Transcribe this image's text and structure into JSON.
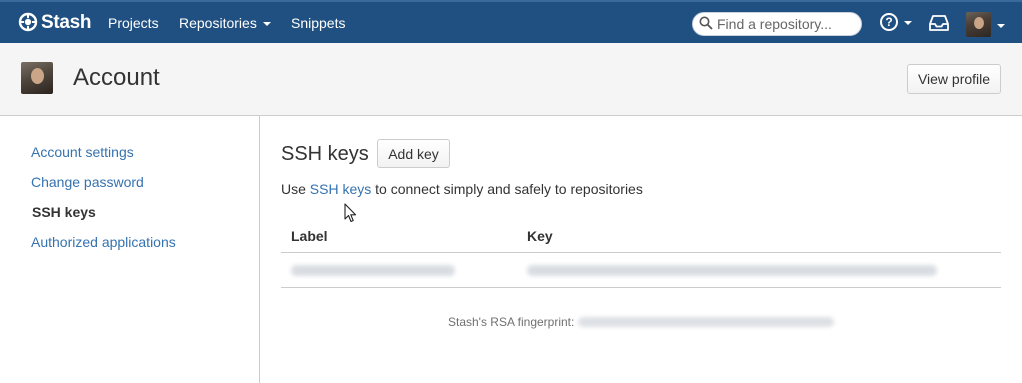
{
  "header": {
    "logo_text": "Stash",
    "nav": [
      {
        "label": "Projects"
      },
      {
        "label": "Repositories"
      },
      {
        "label": "Snippets"
      }
    ],
    "search": {
      "placeholder": "Find a repository..."
    },
    "help_glyph": "?"
  },
  "page": {
    "title": "Account",
    "view_profile_label": "View profile"
  },
  "sidebar": {
    "items": [
      {
        "label": "Account settings",
        "active": false
      },
      {
        "label": "Change password",
        "active": false
      },
      {
        "label": "SSH keys",
        "active": true
      },
      {
        "label": "Authorized applications",
        "active": false
      }
    ]
  },
  "main": {
    "title": "SSH keys",
    "add_key_label": "Add key",
    "description": {
      "prefix": "Use ",
      "link": "SSH keys",
      "suffix": " to connect simply and safely to repositories"
    },
    "table": {
      "columns": [
        "Label",
        "Key"
      ]
    },
    "fingerprint_label": "Stash's RSA fingerprint:"
  },
  "colors": {
    "header_bg": "#205081",
    "link": "#3572b0",
    "page_header_bg": "#f5f5f5"
  },
  "icons": {
    "logo": "stash-logo-icon",
    "search": "search-icon",
    "help": "help-icon",
    "inbox": "inbox-icon",
    "cursor": "mouse-cursor-icon"
  }
}
